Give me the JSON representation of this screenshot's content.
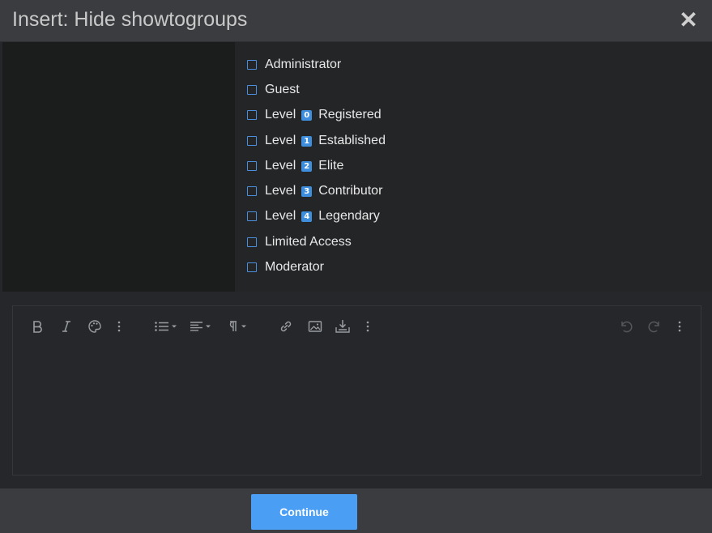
{
  "dialog": {
    "title": "Insert: Hide showtogroups",
    "close_symbol": "✕"
  },
  "groups": [
    {
      "label": "Administrator",
      "checked": false
    },
    {
      "label": "Guest",
      "checked": false
    },
    {
      "prefix": "Level",
      "badge": "0",
      "label": "Registered",
      "checked": false
    },
    {
      "prefix": "Level",
      "badge": "1",
      "label": "Established",
      "checked": false
    },
    {
      "prefix": "Level",
      "badge": "2",
      "label": "Elite",
      "checked": false
    },
    {
      "prefix": "Level",
      "badge": "3",
      "label": "Contributor",
      "checked": false
    },
    {
      "prefix": "Level",
      "badge": "4",
      "label": "Legendary",
      "checked": false
    },
    {
      "label": "Limited Access",
      "checked": false
    },
    {
      "label": "Moderator",
      "checked": false
    }
  ],
  "toolbar": {
    "icons": [
      "bold-icon",
      "italic-icon",
      "palette-icon",
      "more-vertical-icon",
      "list-icon",
      "align-left-icon",
      "paragraph-icon",
      "link-icon",
      "image-icon",
      "insert-icon",
      "more-vertical-icon",
      "undo-icon",
      "redo-icon",
      "more-vertical-icon"
    ]
  },
  "editor": {
    "content": ""
  },
  "footer": {
    "continue_label": "Continue"
  },
  "colors": {
    "accent": "#4a9ff5",
    "badge": "#3e8edd",
    "checkbox_border": "#4a8ee0"
  }
}
